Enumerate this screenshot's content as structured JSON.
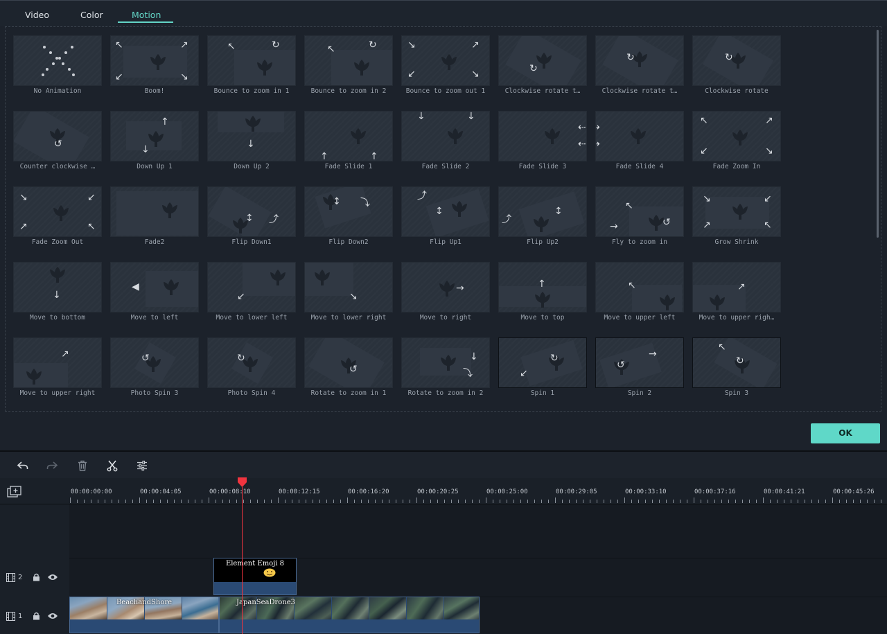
{
  "tabs": [
    {
      "label": "Video"
    },
    {
      "label": "Color"
    },
    {
      "label": "Motion"
    }
  ],
  "presets": [
    {
      "label": "No Animation"
    },
    {
      "label": "Boom!"
    },
    {
      "label": "Bounce to zoom in 1"
    },
    {
      "label": "Bounce to zoom in 2"
    },
    {
      "label": "Bounce to zoom out 1"
    },
    {
      "label": "Clockwise rotate t…"
    },
    {
      "label": "Clockwise rotate t…"
    },
    {
      "label": "Clockwise rotate"
    },
    {
      "label": "Counter clockwise …"
    },
    {
      "label": "Down Up 1"
    },
    {
      "label": "Down Up 2"
    },
    {
      "label": "Fade Slide 1"
    },
    {
      "label": "Fade Slide 2"
    },
    {
      "label": "Fade Slide 3"
    },
    {
      "label": "Fade Slide 4"
    },
    {
      "label": "Fade Zoom In"
    },
    {
      "label": "Fade Zoom Out"
    },
    {
      "label": "Fade2"
    },
    {
      "label": "Flip Down1"
    },
    {
      "label": "Flip Down2"
    },
    {
      "label": "Flip Up1"
    },
    {
      "label": "Flip Up2"
    },
    {
      "label": "Fly to zoom in"
    },
    {
      "label": "Grow Shrink"
    },
    {
      "label": "Move to bottom"
    },
    {
      "label": "Move to left"
    },
    {
      "label": "Move to lower left"
    },
    {
      "label": "Move to lower right"
    },
    {
      "label": "Move to right"
    },
    {
      "label": "Move to top"
    },
    {
      "label": "Move to upper left"
    },
    {
      "label": "Move to upper righ…"
    },
    {
      "label": "Move to upper right"
    },
    {
      "label": "Photo Spin 3"
    },
    {
      "label": "Photo Spin 4"
    },
    {
      "label": "Rotate to zoom in 1"
    },
    {
      "label": "Rotate to zoom in 2"
    },
    {
      "label": "Spin 1"
    },
    {
      "label": "Spin 2"
    },
    {
      "label": "Spin 3"
    }
  ],
  "ok_label": "OK",
  "toolbar": {
    "tools": [
      "undo-icon",
      "redo-icon",
      "trash-icon",
      "scissors-icon",
      "adjust-icon"
    ]
  },
  "timeline": {
    "timecodes": [
      "00:00:00:00",
      "00:00:04:05",
      "00:00:08:10",
      "00:00:12:15",
      "00:00:16:20",
      "00:00:20:25",
      "00:00:25:00",
      "00:00:29:05",
      "00:00:33:10",
      "00:00:37:16",
      "00:00:41:21",
      "00:00:45:26"
    ],
    "tracks": [
      {
        "number": "2"
      },
      {
        "number": "1"
      }
    ],
    "clips": {
      "emoji": {
        "title": "Element Emoji 8"
      },
      "beach": {
        "title": "BeachandShore"
      },
      "japan": {
        "title": "JapanSeaDrone3"
      }
    }
  },
  "colors": {
    "accent": "#63d6c7",
    "ok_button": "#5fd8c8",
    "playhead": "#f0343f",
    "clip_blue": "#2a4a74"
  }
}
